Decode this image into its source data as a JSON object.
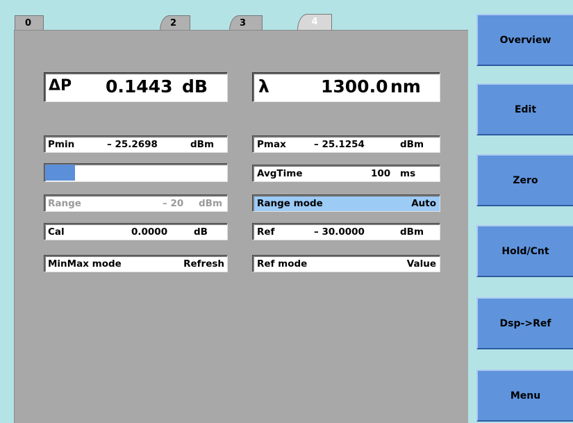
{
  "tabs": {
    "t0": "0",
    "t2": "2",
    "t3": "3",
    "t4": "4"
  },
  "display": {
    "delta_p": {
      "symbol": "ΔP",
      "value": "0.1443",
      "unit": "dB"
    },
    "wavelength": {
      "symbol": "λ",
      "value": "1300.0",
      "unit": "nm"
    }
  },
  "fields": {
    "pmin": {
      "label": "Pmin",
      "value": "– 25.2698",
      "unit": "dBm"
    },
    "pmax": {
      "label": "Pmax",
      "value": "– 25.1254",
      "unit": "dBm"
    },
    "level_bar": {
      "fill": 0.165,
      "color": "#5b8fd9"
    },
    "avgtime": {
      "label": "AvgTime",
      "value": "100",
      "unit": "ms"
    },
    "range": {
      "label": "Range",
      "value": "– 20",
      "unit": "dBm"
    },
    "range_mode": {
      "label": "Range mode",
      "value": "Auto"
    },
    "cal": {
      "label": "Cal",
      "value": "0.0000",
      "unit": "dB"
    },
    "ref": {
      "label": "Ref",
      "value": "– 30.0000",
      "unit": "dBm"
    },
    "minmax_mode": {
      "label": "MinMax mode",
      "value": "Refresh"
    },
    "ref_mode": {
      "label": "Ref mode",
      "value": "Value"
    }
  },
  "softkeys": {
    "overview": "Overview",
    "edit": "Edit",
    "zero": "Zero",
    "holdcnt": "Hold/Cnt",
    "dspref": "Dsp->Ref",
    "menu": "Menu"
  },
  "colors": {
    "background": "#b4e3e6",
    "panel": "#a8a8a8",
    "softkey": "#5f94dd",
    "highlight": "#9ccbf6"
  }
}
